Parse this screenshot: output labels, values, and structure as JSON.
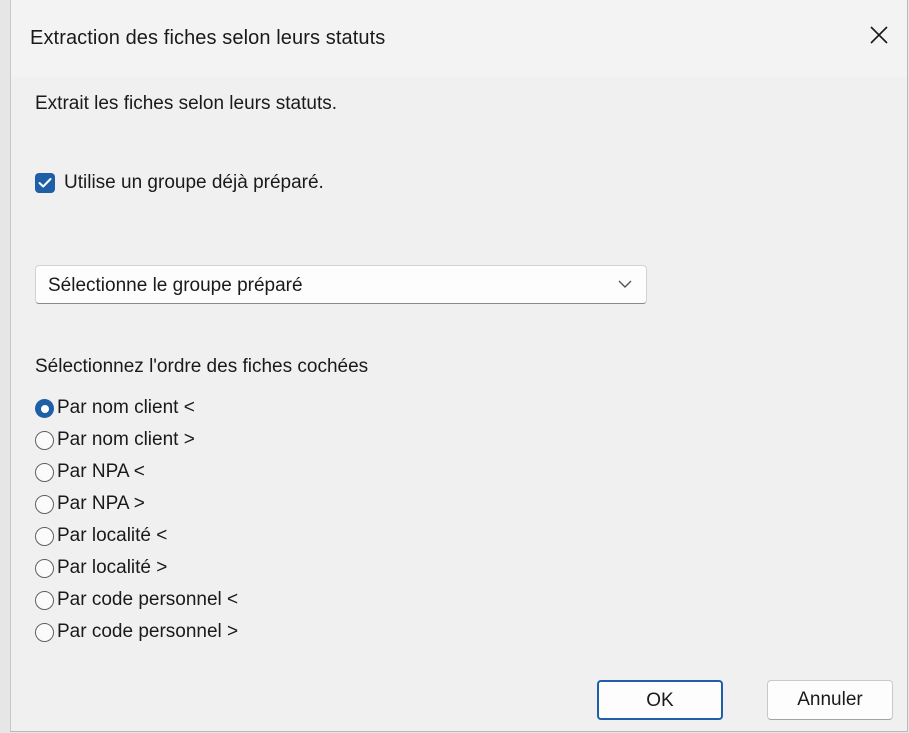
{
  "window": {
    "title": "Extraction des fiches selon leurs statuts",
    "close_icon": "close-icon"
  },
  "intro_text": "Extrait les fiches selon leurs statuts.",
  "use_group_checkbox": {
    "label": "Utilise un groupe déjà préparé.",
    "checked": true
  },
  "group_select": {
    "value": "Sélectionne le groupe préparé",
    "icon": "chevron-down-icon"
  },
  "order_section": {
    "heading": "Sélectionnez l'ordre des fiches cochées",
    "options": [
      {
        "label": "Par nom client <",
        "selected": true
      },
      {
        "label": "Par nom client >",
        "selected": false
      },
      {
        "label": "Par NPA <",
        "selected": false
      },
      {
        "label": "Par NPA >",
        "selected": false
      },
      {
        "label": "Par localité <",
        "selected": false
      },
      {
        "label": "Par localité >",
        "selected": false
      },
      {
        "label": "Par code personnel <",
        "selected": false
      },
      {
        "label": "Par code personnel >",
        "selected": false
      }
    ]
  },
  "buttons": {
    "ok_label": "OK",
    "cancel_label": "Annuler"
  },
  "colors": {
    "accent": "#1f5fa8",
    "dialog_background": "#f0f0f0"
  }
}
